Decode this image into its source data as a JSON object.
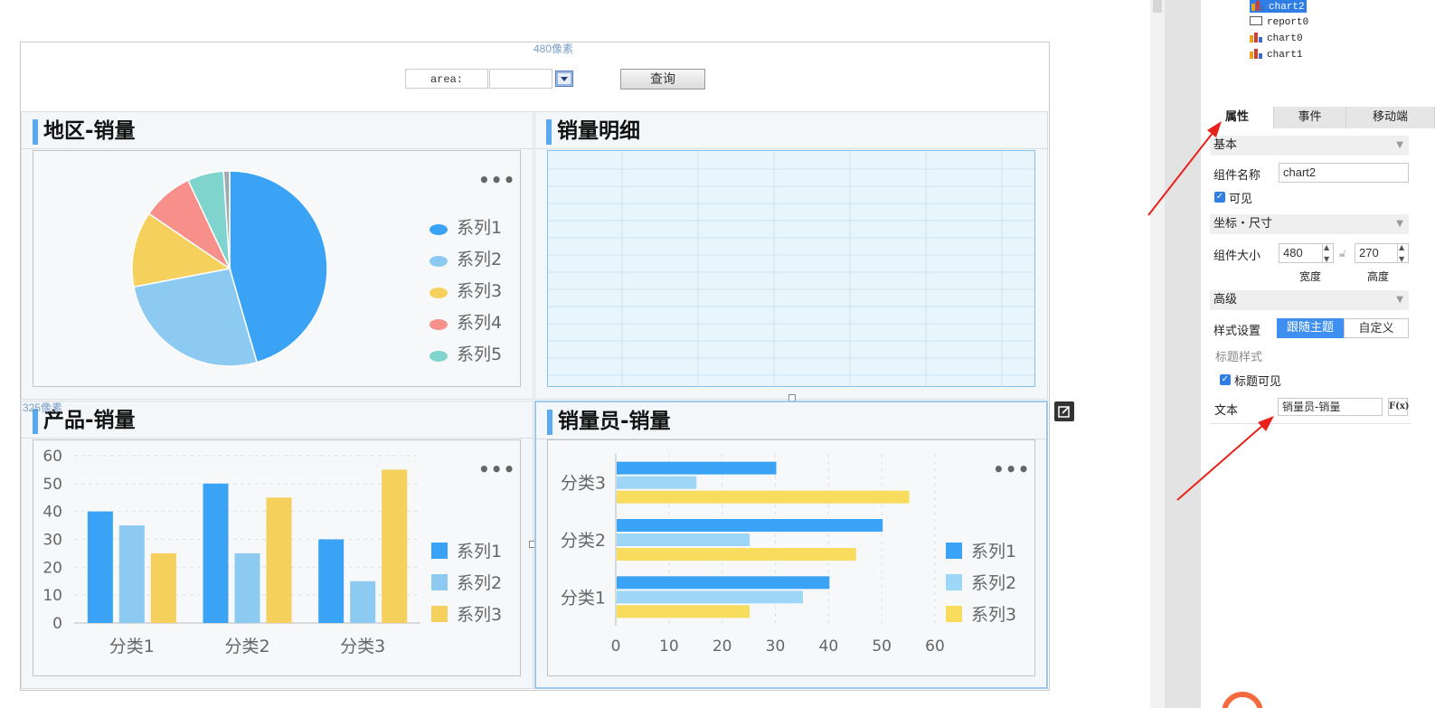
{
  "canvas": {
    "width_label": "480像素",
    "height_label": "325像素",
    "param_label": "area:",
    "param_value": "",
    "query_button": "查询"
  },
  "panels": {
    "pie": {
      "title": "地区-销量",
      "more": "•••"
    },
    "table": {
      "title": "销量明细"
    },
    "bar": {
      "title": "产品-销量",
      "more": "•••"
    },
    "hbar": {
      "title": "销量员-销量",
      "more": "•••"
    }
  },
  "chart_data": [
    {
      "type": "pie",
      "title": "地区-销量",
      "series": [
        {
          "name": "系列1",
          "value": 45.5,
          "color": "#3aa3f5"
        },
        {
          "name": "系列2",
          "value": 26.5,
          "color": "#8ccaf2"
        },
        {
          "name": "系列3",
          "value": 12.5,
          "color": "#f5d05c"
        },
        {
          "name": "系列4",
          "value": 8.5,
          "color": "#f7908b"
        },
        {
          "name": "系列5",
          "value": 6.0,
          "color": "#7fd5cd"
        },
        {
          "name": "",
          "value": 1.0,
          "color": "#a0a8b0"
        }
      ],
      "legend": "right"
    },
    {
      "type": "bar",
      "title": "产品-销量",
      "categories": [
        "分类1",
        "分类2",
        "分类3"
      ],
      "series": [
        {
          "name": "系列1",
          "values": [
            40,
            50,
            30
          ],
          "color": "#3aa3f5"
        },
        {
          "name": "系列2",
          "values": [
            35,
            25,
            15
          ],
          "color": "#8ccaf2"
        },
        {
          "name": "系列3",
          "values": [
            25,
            45,
            55
          ],
          "color": "#f5d05c"
        }
      ],
      "ylim": [
        0,
        60
      ],
      "yticks": [
        "0",
        "10",
        "20",
        "30",
        "40",
        "50",
        "60"
      ],
      "grid": true,
      "legend": "right"
    },
    {
      "type": "bar",
      "orientation": "horizontal",
      "title": "销量员-销量",
      "categories": [
        "分类1",
        "分类2",
        "分类3"
      ],
      "series": [
        {
          "name": "系列1",
          "values": [
            40,
            50,
            30
          ],
          "color": "#3aa3f5"
        },
        {
          "name": "系列2",
          "values": [
            35,
            25,
            15
          ],
          "color": "#9dd6f7"
        },
        {
          "name": "系列3",
          "values": [
            25,
            45,
            55
          ],
          "color": "#f8dc5e"
        }
      ],
      "xlim": [
        0,
        60
      ],
      "xticks": [
        "0",
        "10",
        "20",
        "30",
        "40",
        "50",
        "60"
      ],
      "grid": true,
      "legend": "right"
    }
  ],
  "tree": {
    "items": [
      "chart2",
      "report0",
      "chart0",
      "chart1"
    ],
    "selected": "chart2"
  },
  "tabs": [
    "属性",
    "事件",
    "移动端"
  ],
  "properties": {
    "basic_section": "基本",
    "name_label": "组件名称",
    "name_value": "chart2",
    "visible_label": "可见",
    "coord_section": "坐标・尺寸",
    "size_label": "组件大小",
    "width_value": "480",
    "height_value": "270",
    "width_caption": "宽度",
    "height_caption": "高度",
    "advanced_section": "高级",
    "style_label": "样式设置",
    "style_follow": "跟随主题",
    "style_custom": "自定义",
    "title_style_label": "标题样式",
    "title_visible_label": "标题可见",
    "text_label": "文本",
    "text_value": "销量员-销量",
    "fx_label": "F(x)"
  },
  "colors": {
    "accent": "#5aa8ef",
    "selected_tab": "#2f7ee6",
    "arrow": "#e8221a"
  }
}
